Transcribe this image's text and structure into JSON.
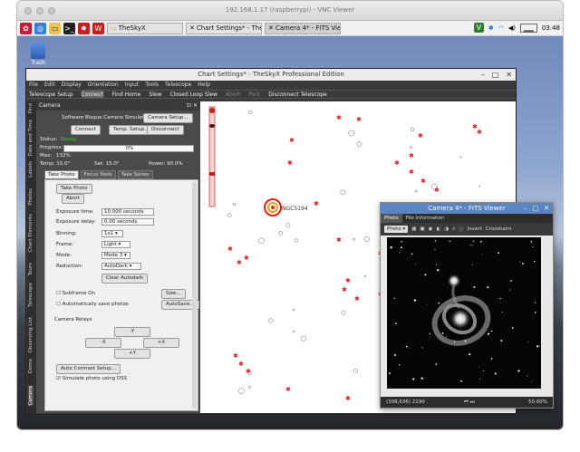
{
  "vnc": {
    "host": "192.168.1.17 (raspberrypi) - VNC Viewer"
  },
  "taskbar": {
    "tasks": [
      "TheSkyX",
      "Chart Settings* - The...",
      "Camera 4* - FITS Vie..."
    ],
    "clock": "03:48"
  },
  "desktop": {
    "trash_label": "Trash"
  },
  "skyx": {
    "title": "Chart Settings* - TheSkyX Professional Edition",
    "menu": [
      "File",
      "Edit",
      "Display",
      "Orientation",
      "Input",
      "Tools",
      "Telescope",
      "Help"
    ],
    "toolbar": [
      "Telescope Setup",
      "Connect",
      "Find Home",
      "Slew",
      "Closed Loop Slew",
      "Abort",
      "Park",
      "Disconnect Telescope"
    ],
    "side_tabs": [
      "Find",
      "Date and Time",
      "Labels",
      "Photos",
      "Chart Elements",
      "Tours",
      "Telescope",
      "Observing List",
      "Dome",
      "Camera"
    ],
    "camera": {
      "header": "Camera",
      "driver": "Software Bisque Camera Simulator",
      "setup_btn": "Camera Setup...",
      "connect_btn": "Connect",
      "temp_setup_btn": "Temp. Setup...",
      "disconnect_btn": "Disconnect",
      "status_label": "Status:",
      "status_value": "Ready",
      "progress_label": "Progress:",
      "progress_value": "0%",
      "max_label": "Max:",
      "max_value": "132%",
      "temp_label": "Temp: 15.0°",
      "set_label": "Set: 15.0°",
      "power_label": "Power: 90.0%",
      "sub_tabs": [
        "Take Photo",
        "Focus Tools",
        "Take Series"
      ],
      "take_photo_btn": "Take Photo",
      "abort_btn": "Abort",
      "exposure_label": "Exposure time:",
      "exposure_value": "10.000 seconds",
      "delay_label": "Exposure delay:",
      "delay_value": "0.00 seconds",
      "binning_label": "Binning:",
      "binning_value": "1x1",
      "frame_label": "Frame:",
      "frame_value": "Light",
      "mode_label": "Mode:",
      "mode_value": "Mode 3",
      "reduction_label": "Reduction:",
      "reduction_value": "AutoDark",
      "clear_btn": "Clear Autodark",
      "subframe_label": "Subframe On",
      "size_btn": "Size...",
      "autosave_label": "Automatically save photos",
      "autosave_btn": "AutoSave...",
      "relays_label": "Camera Relays",
      "relay_up": "-Y",
      "relay_left": "-X",
      "relay_right": "+X",
      "relay_down": "+Y",
      "contrast_btn": "Auto Contrast Setup...",
      "simulate_label": "Simulate photo using DSS"
    },
    "chart": {
      "galaxy_label": "NGC5194"
    }
  },
  "fits": {
    "title": "Camera 4* - FITS Viewer",
    "tabs": [
      "Photo",
      "File Information"
    ],
    "photo_select": "Photo",
    "invert": "Invert",
    "crosshairs": "Crosshairs",
    "coords": "(308,636) 2190",
    "zoom": "50.00%"
  },
  "colors": {
    "accent": "#5a84c4",
    "status_ready": "#35d135",
    "marker": "#e02020"
  }
}
